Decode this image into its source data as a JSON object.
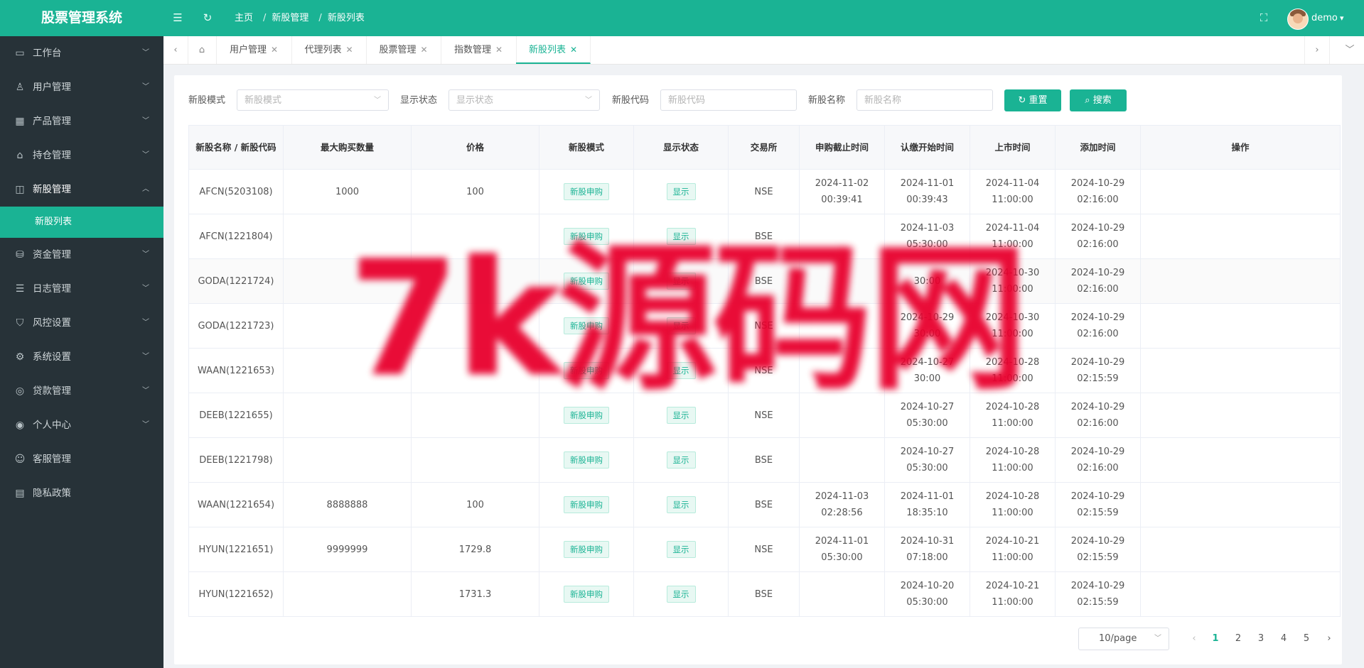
{
  "app": {
    "title": "股票管理系统",
    "accent_color": "#1ab394",
    "sidebar_color": "#273238"
  },
  "header": {
    "breadcrumb": [
      "主页",
      "新股管理",
      "新股列表"
    ],
    "user": "demo",
    "icons": [
      "menu-fold-icon",
      "refresh-icon",
      "fullscreen-icon",
      "avatar"
    ]
  },
  "sidebar": {
    "items": [
      {
        "label": "工作台",
        "icon": "monitor-icon",
        "open": false
      },
      {
        "label": "用户管理",
        "icon": "user-gear-icon",
        "open": false
      },
      {
        "label": "产品管理",
        "icon": "grid-icon",
        "open": false
      },
      {
        "label": "持仓管理",
        "icon": "home-icon",
        "open": false
      },
      {
        "label": "新股管理",
        "icon": "chart-icon",
        "open": true
      },
      {
        "label": "资金管理",
        "icon": "coins-icon",
        "open": false
      },
      {
        "label": "日志管理",
        "icon": "log-icon",
        "open": false
      },
      {
        "label": "风控设置",
        "icon": "shield-icon",
        "open": false
      },
      {
        "label": "系统设置",
        "icon": "settings-icon",
        "open": false
      },
      {
        "label": "贷款管理",
        "icon": "loan-icon",
        "open": false
      },
      {
        "label": "个人中心",
        "icon": "person-icon",
        "open": false
      },
      {
        "label": "客服管理",
        "icon": "support-icon",
        "open": false
      },
      {
        "label": "隐私政策",
        "icon": "doc-icon",
        "open": false
      }
    ],
    "submenu": {
      "label": "新股列表"
    }
  },
  "tabs": [
    {
      "label": "用户管理",
      "active": false
    },
    {
      "label": "代理列表",
      "active": false
    },
    {
      "label": "股票管理",
      "active": false
    },
    {
      "label": "指数管理",
      "active": false
    },
    {
      "label": "新股列表",
      "active": true
    }
  ],
  "filters": {
    "mode": {
      "label": "新股模式",
      "placeholder": "新股模式"
    },
    "status": {
      "label": "显示状态",
      "placeholder": "显示状态"
    },
    "code": {
      "label": "新股代码",
      "placeholder": "新股代码"
    },
    "name": {
      "label": "新股名称",
      "placeholder": "新股名称"
    },
    "reset_label": "重置",
    "search_label": "搜索"
  },
  "table": {
    "columns": [
      "新股名称 / 新股代码",
      "最大购买数量",
      "价格",
      "新股模式",
      "显示状态",
      "交易所",
      "申购截止时间",
      "认缴开始时间",
      "上市时间",
      "添加时间",
      "操作"
    ],
    "rows": [
      {
        "name": "AFCN(5203108)",
        "max": "1000",
        "price": "100",
        "mode": "新股申购",
        "status": "显示",
        "exchange": "NSE",
        "deadline": "2024-11-02 00:39:41",
        "subscribe": "2024-11-01 00:39:43",
        "listing": "2024-11-04 11:00:00",
        "added": "2024-10-29 02:16:00"
      },
      {
        "name": "AFCN(1221804)",
        "max": "",
        "price": "",
        "mode": "新股申购",
        "status": "显示",
        "exchange": "BSE",
        "deadline": "",
        "subscribe": "2024-11-03 05:30:00",
        "listing": "2024-11-04 11:00:00",
        "added": "2024-10-29 02:16:00"
      },
      {
        "name": "GODA(1221724)",
        "max": "",
        "price": "",
        "mode": "新股申购",
        "status": "显示",
        "exchange": "BSE",
        "deadline": "",
        "subscribe": "30:00",
        "listing": "2024-10-30 11:00:00",
        "added": "2024-10-29 02:16:00"
      },
      {
        "name": "GODA(1221723)",
        "max": "",
        "price": "",
        "mode": "新股申购",
        "status": "显示",
        "exchange": "NSE",
        "deadline": "",
        "subscribe": "2024-10-29 30:00",
        "listing": "2024-10-30 11:00:00",
        "added": "2024-10-29 02:16:00"
      },
      {
        "name": "WAAN(1221653)",
        "max": "",
        "price": "",
        "mode": "新股申购",
        "status": "显示",
        "exchange": "NSE",
        "deadline": "",
        "subscribe": "2024-10-27 30:00",
        "listing": "2024-10-28 11:00:00",
        "added": "2024-10-29 02:15:59"
      },
      {
        "name": "DEEB(1221655)",
        "max": "",
        "price": "",
        "mode": "新股申购",
        "status": "显示",
        "exchange": "NSE",
        "deadline": "",
        "subscribe": "2024-10-27 05:30:00",
        "listing": "2024-10-28 11:00:00",
        "added": "2024-10-29 02:16:00"
      },
      {
        "name": "DEEB(1221798)",
        "max": "",
        "price": "",
        "mode": "新股申购",
        "status": "显示",
        "exchange": "BSE",
        "deadline": "",
        "subscribe": "2024-10-27 05:30:00",
        "listing": "2024-10-28 11:00:00",
        "added": "2024-10-29 02:16:00"
      },
      {
        "name": "WAAN(1221654)",
        "max": "8888888",
        "price": "100",
        "mode": "新股申购",
        "status": "显示",
        "exchange": "BSE",
        "deadline": "2024-11-03 02:28:56",
        "subscribe": "2024-11-01 18:35:10",
        "listing": "2024-10-28 11:00:00",
        "added": "2024-10-29 02:15:59"
      },
      {
        "name": "HYUN(1221651)",
        "max": "9999999",
        "price": "1729.8",
        "mode": "新股申购",
        "status": "显示",
        "exchange": "NSE",
        "deadline": "2024-11-01 05:30:00",
        "subscribe": "2024-10-31 07:18:00",
        "listing": "2024-10-21 11:00:00",
        "added": "2024-10-29 02:15:59"
      },
      {
        "name": "HYUN(1221652)",
        "max": "",
        "price": "1731.3",
        "mode": "新股申购",
        "status": "显示",
        "exchange": "BSE",
        "deadline": "",
        "subscribe": "2024-10-20 05:30:00",
        "listing": "2024-10-21 11:00:00",
        "added": "2024-10-29 02:15:59"
      }
    ]
  },
  "pagination": {
    "page_size": "10/page",
    "pages": [
      "1",
      "2",
      "3",
      "4",
      "5"
    ],
    "current": "1"
  },
  "watermark": "7k源码网"
}
